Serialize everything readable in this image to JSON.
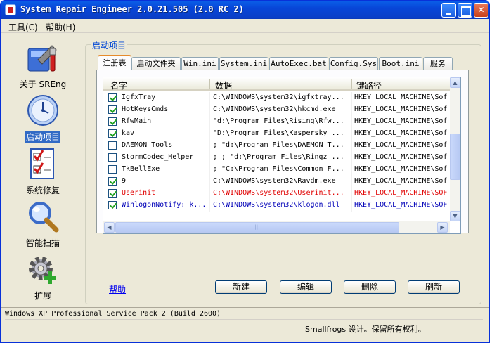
{
  "window": {
    "title": "System Repair Engineer 2.0.21.505 (2.0 RC 2)"
  },
  "menu": [
    "工具(C)",
    "帮助(H)"
  ],
  "sidebar": {
    "items": [
      {
        "label": "关于 SREng",
        "icon": "tools-icon"
      },
      {
        "label": "启动项目",
        "icon": "clock-icon",
        "selected": true
      },
      {
        "label": "系统修复",
        "icon": "checklist-icon"
      },
      {
        "label": "智能扫描",
        "icon": "magnifier-icon"
      },
      {
        "label": "扩展",
        "icon": "gear-plus-icon"
      }
    ]
  },
  "group": {
    "label": "启动项目"
  },
  "tabs": [
    "注册表",
    "启动文件夹",
    "Win.ini",
    "System.ini",
    "AutoExec.bat",
    "Config.Sys",
    "Boot.ini",
    "服务"
  ],
  "list": {
    "columns": [
      "名字",
      "数据",
      "键路径"
    ],
    "rows": [
      {
        "checked": true,
        "name": "IgfxTray",
        "data": "C:\\WINDOWS\\system32\\igfxtray...",
        "key": "HKEY_LOCAL_MACHINE\\Sof",
        "style": ""
      },
      {
        "checked": true,
        "name": "HotKeysCmds",
        "data": "C:\\WINDOWS\\system32\\hkcmd.exe",
        "key": "HKEY_LOCAL_MACHINE\\Sof",
        "style": ""
      },
      {
        "checked": true,
        "name": "RfwMain",
        "data": "\"d:\\Program Files\\Rising\\Rfw...",
        "key": "HKEY_LOCAL_MACHINE\\Sof",
        "style": ""
      },
      {
        "checked": true,
        "name": "kav",
        "data": "\"D:\\Program Files\\Kaspersky ...",
        "key": "HKEY_LOCAL_MACHINE\\Sof",
        "style": ""
      },
      {
        "checked": false,
        "name": "DAEMON Tools",
        "data": "; \"d:\\Program Files\\DAEMON T...",
        "key": "HKEY_LOCAL_MACHINE\\Sof",
        "style": ""
      },
      {
        "checked": false,
        "name": "StormCodec_Helper",
        "data": "; ; \"d:\\Program Files\\Ringz ...",
        "key": "HKEY_LOCAL_MACHINE\\Sof",
        "style": ""
      },
      {
        "checked": false,
        "name": "TkBellExe",
        "data": "; \"C:\\Program Files\\Common F...",
        "key": "HKEY_LOCAL_MACHINE\\Sof",
        "style": ""
      },
      {
        "checked": true,
        "name": "9",
        "data": "C:\\WINDOWS\\system32\\Ravdm.exe",
        "key": "HKEY_LOCAL_MACHINE\\Sof",
        "style": ""
      },
      {
        "checked": true,
        "name": "Userinit",
        "data": "C:\\WINDOWS\\system32\\Userinit...",
        "key": "HKEY_LOCAL_MACHINE\\SOF",
        "style": "red"
      },
      {
        "checked": true,
        "name": "WinlogonNotify: k...",
        "data": "C:\\WINDOWS\\system32\\klogon.dll",
        "key": "HKEY_LOCAL_MACHINE\\SOF",
        "style": "blue"
      }
    ]
  },
  "scroll_glyphs": {
    "up": "▲",
    "down": "▼",
    "left": "◀",
    "right": "▶",
    "grip": "|||"
  },
  "help_link": "帮助",
  "buttons": [
    "新建",
    "编辑",
    "删除",
    "刷新"
  ],
  "status": {
    "os": "Windows XP Professional Service Pack 2 (Build 2600)",
    "copyright": "Smallfrogs 设计。保留所有权利。"
  },
  "colors": {
    "titlebar": "#0a48d8",
    "selection": "#316ac5",
    "red_row": "#e00000",
    "blue_row": "#0000b8"
  }
}
